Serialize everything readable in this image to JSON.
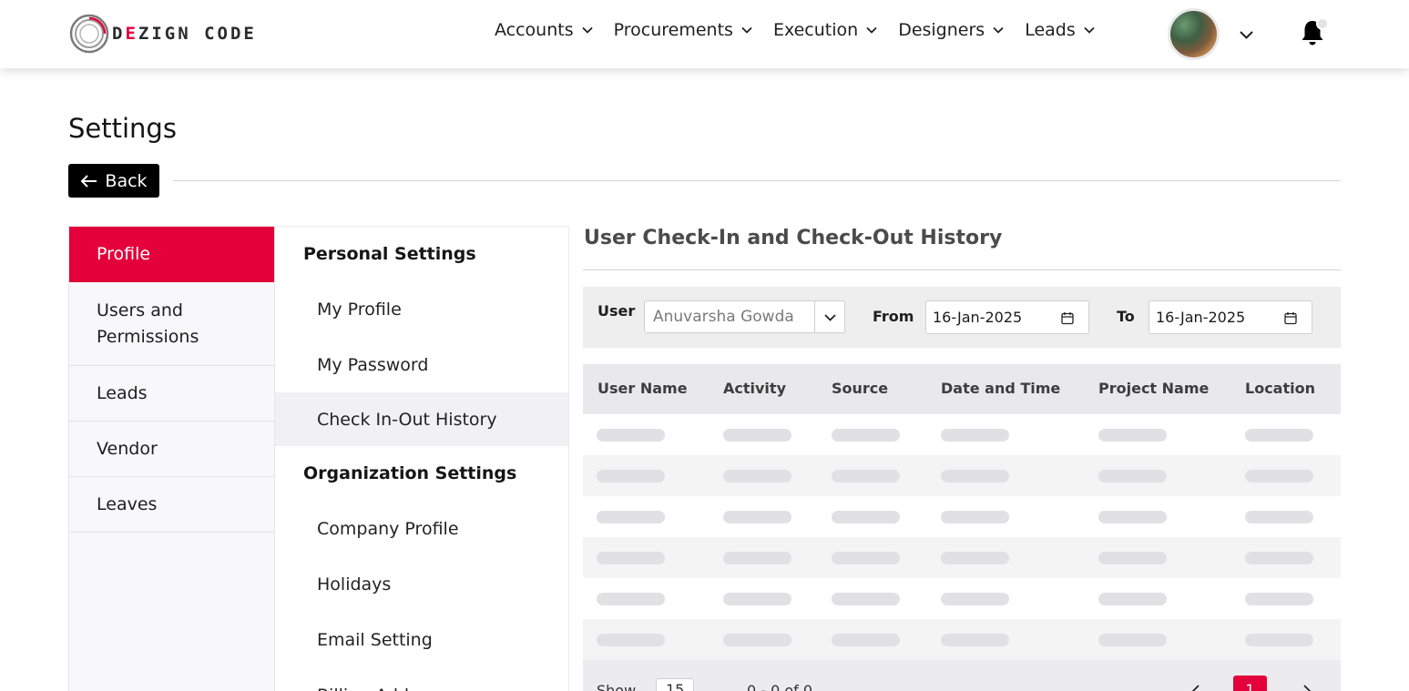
{
  "header": {
    "logo_text_pre": "D",
    "logo_text_accent": "E",
    "logo_text_post": "ZIGN CODE",
    "nav": [
      {
        "label": "Accounts"
      },
      {
        "label": "Procurements"
      },
      {
        "label": "Execution"
      },
      {
        "label": "Designers"
      },
      {
        "label": "Leads"
      }
    ]
  },
  "page": {
    "title": "Settings",
    "back_label": "Back"
  },
  "sidebar": {
    "items": [
      {
        "label": "Profile",
        "active": true
      },
      {
        "label": "Users and Permissions"
      },
      {
        "label": "Leads"
      },
      {
        "label": "Vendor"
      },
      {
        "label": "Leaves"
      }
    ]
  },
  "submenu": {
    "personal_heading": "Personal Settings",
    "personal_items": [
      "My Profile",
      "My Password",
      "Check In-Out History"
    ],
    "org_heading": "Organization Settings",
    "org_items": [
      "Company Profile",
      "Holidays",
      "Email Setting",
      "Billing Address"
    ]
  },
  "content": {
    "title": "User Check-In and Check-Out History",
    "filters": {
      "user_label": "User",
      "user_value": "Anuvarsha Gowda",
      "from_label": "From",
      "from_value": "16-Jan-2025",
      "to_label": "To",
      "to_value": "16-Jan-2025"
    },
    "table": {
      "columns": [
        "User Name",
        "Activity",
        "Source",
        "Date and Time",
        "Project Name",
        "Location"
      ]
    },
    "footer": {
      "show_label": "Show",
      "page_size": "15",
      "range_text": "0 - 0 of 0",
      "current_page": "1"
    }
  },
  "colors": {
    "accent": "#e4003a",
    "back_button": "#000000"
  }
}
